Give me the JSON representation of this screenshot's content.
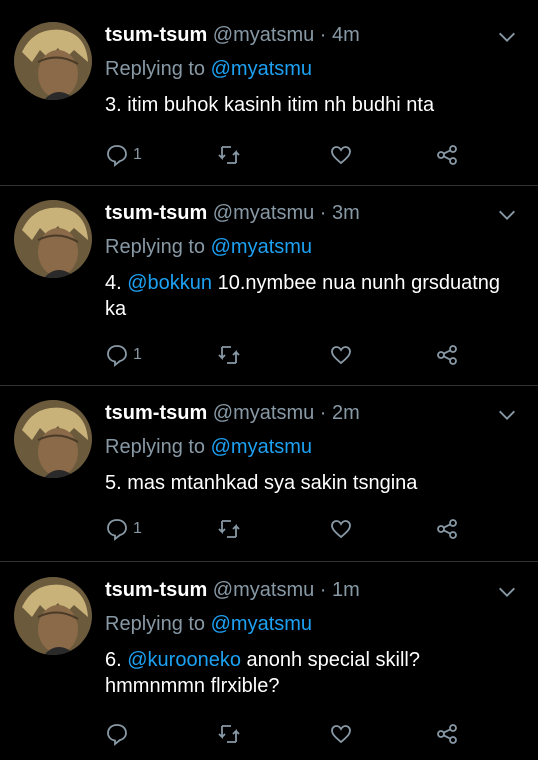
{
  "colors": {
    "background": "#000000",
    "text": "#ffffff",
    "muted": "#8899a6",
    "link": "#1da1f2",
    "divider": "#2f3336"
  },
  "tweets": [
    {
      "name": "tsum-tsum",
      "handle": "@myatsmu",
      "time": "4m",
      "replying_label": "Replying to",
      "replying_to": "@myatsmu",
      "text_prefix": "3. itim buhok kasinh itim nh budhi nta",
      "text_mention": "",
      "text_suffix": "",
      "reply_count": "1"
    },
    {
      "name": "tsum-tsum",
      "handle": "@myatsmu",
      "time": "3m",
      "replying_label": "Replying to",
      "replying_to": "@myatsmu",
      "text_prefix": "4. ",
      "text_mention": "@bokkun",
      "text_suffix": " 10.nymbee nua nunh grsduatng ka",
      "reply_count": "1"
    },
    {
      "name": "tsum-tsum",
      "handle": "@myatsmu",
      "time": "2m",
      "replying_label": "Replying to",
      "replying_to": "@myatsmu",
      "text_prefix": "5. mas mtanhkad sya sakin tsngina",
      "text_mention": "",
      "text_suffix": "",
      "reply_count": "1"
    },
    {
      "name": "tsum-tsum",
      "handle": "@myatsmu",
      "time": "1m",
      "replying_label": "Replying to",
      "replying_to": "@myatsmu",
      "text_prefix": "6. ",
      "text_mention": "@kurooneko",
      "text_suffix": " anonh special skill? hmmnmmn flrxible?",
      "reply_count": ""
    }
  ],
  "separator": "·",
  "icons": {
    "reply": "reply-icon",
    "retweet": "retweet-icon",
    "like": "like-icon",
    "share": "share-icon",
    "caret": "chevron-down-icon"
  }
}
